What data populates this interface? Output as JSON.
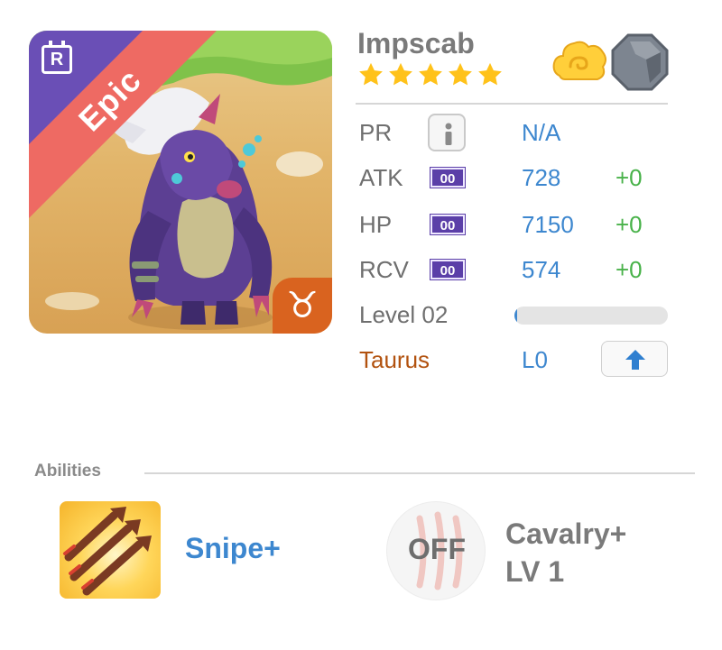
{
  "monster": {
    "name": "Impscab",
    "stars": 5,
    "rarity": "Epic",
    "rarity_color": "#ee6a63",
    "badge": "R",
    "zodiac_glyph": "♉",
    "zodiac_glyph_color": "#d9631f"
  },
  "stats": [
    {
      "label": "PR",
      "value": "N/A",
      "icon": "info-icon"
    },
    {
      "label": "ATK",
      "pill": "00",
      "value": "728",
      "bonus": "+0"
    },
    {
      "label": "HP",
      "pill": "00",
      "value": "7150",
      "bonus": "+0"
    },
    {
      "label": "RCV",
      "pill": "00",
      "value": "574",
      "bonus": "+0"
    }
  ],
  "level": {
    "label": "Level 02",
    "progress": 0.02
  },
  "zodiac": {
    "name": "Taurus",
    "level": "L0"
  },
  "abilities": {
    "title": "Abilities",
    "active": {
      "name": "Snipe+",
      "icon": "triple-arrow-icon"
    },
    "passive": {
      "status": "OFF",
      "name": "Cavalry+",
      "level": "LV 1",
      "icon": "claw-marks-icon"
    }
  },
  "colors": {
    "value_blue": "#3d87cf",
    "bonus_green": "#49b24a",
    "pill_purple": "#5b3fa8",
    "zodiac_brown": "#b2520f",
    "star_yellow": "#ffc21a"
  }
}
